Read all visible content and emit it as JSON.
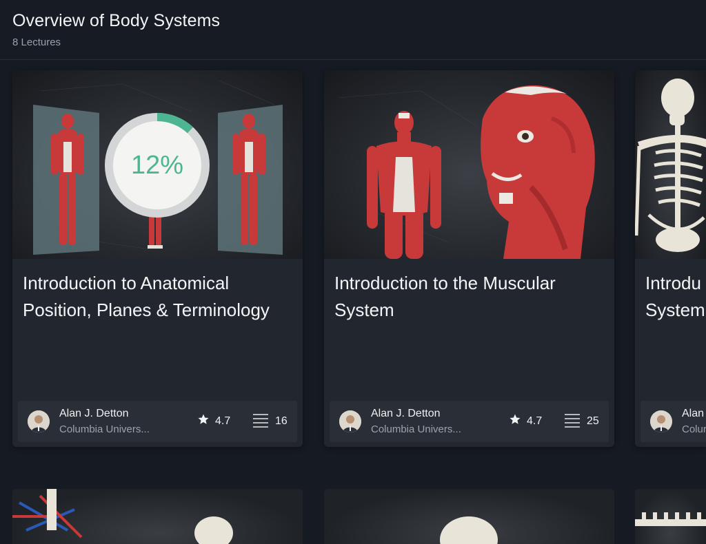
{
  "header": {
    "title": "Overview of Body Systems",
    "subtitle": "8 Lectures"
  },
  "colors": {
    "background": "#161a22",
    "card": "#22262f",
    "footer": "#2a2e37",
    "progress_accent": "#4eb592",
    "muscle_red": "#c8393a"
  },
  "cards": [
    {
      "title": "Introduction to Anatomical Position, Planes & Terminology",
      "thumbnail": "anatomical-planes-figures",
      "progress": {
        "percent_label": "12%",
        "fraction": 0.12
      },
      "author": {
        "name": "Alan J. Detton",
        "institution": "Columbia Univers..."
      },
      "rating": "4.7",
      "rating_icon": "star-icon",
      "lecture_count": "16",
      "lecture_icon": "list-icon"
    },
    {
      "title": "Introduction to the Muscular System",
      "thumbnail": "muscular-system-figure-and-head",
      "author": {
        "name": "Alan J. Detton",
        "institution": "Columbia Univers..."
      },
      "rating": "4.7",
      "rating_icon": "star-icon",
      "lecture_count": "25",
      "lecture_icon": "list-icon"
    },
    {
      "title": "Introdu",
      "title_line2": "System",
      "thumbnail": "skeletal-system-figure",
      "author": {
        "name": "Alan",
        "institution": "Colur"
      }
    }
  ]
}
